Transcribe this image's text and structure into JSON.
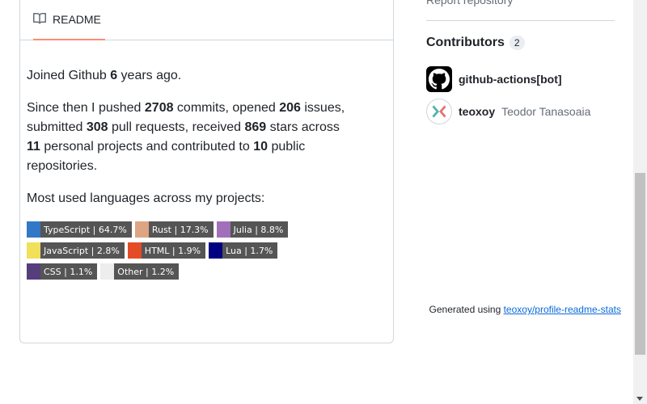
{
  "readme": {
    "tab_label": "README",
    "joined": {
      "prefix": "Joined Github ",
      "years": "6",
      "suffix": " years ago."
    },
    "stats": {
      "p1": "Since then I pushed ",
      "commits": "2708",
      "p2": " commits, opened ",
      "issues": "206",
      "p3": " issues, submitted ",
      "prs": "308",
      "p4": " pull requests, received ",
      "stars": "869",
      "p5": " stars across ",
      "projects": "11",
      "p6": " personal projects and contributed to ",
      "public": "10",
      "p7": " public repositories."
    },
    "langs_heading": "Most used languages across my projects:",
    "languages": [
      {
        "label": "TypeScript | 64.7%",
        "color": "#3178c6"
      },
      {
        "label": "Rust | 17.3%",
        "color": "#dea584"
      },
      {
        "label": "Julia | 8.8%",
        "color": "#a270ba"
      },
      {
        "label": "JavaScript | 2.8%",
        "color": "#f1e05a"
      },
      {
        "label": "HTML | 1.9%",
        "color": "#e34c26"
      },
      {
        "label": "Lua | 1.7%",
        "color": "#000080"
      },
      {
        "label": "CSS | 1.1%",
        "color": "#563d7c"
      },
      {
        "label": "Other | 1.2%",
        "color": "#ededed"
      }
    ],
    "generated_prefix": "Generated using ",
    "generated_link": "teoxoy/profile-readme-stats"
  },
  "sidebar": {
    "report_link": "Report repository",
    "contributors_title": "Contributors",
    "contributors_count": "2",
    "contributors": [
      {
        "login": "github-actions[bot]",
        "name": ""
      },
      {
        "login": "teoxoy",
        "name": "Teodor Tanasoaia"
      }
    ]
  }
}
